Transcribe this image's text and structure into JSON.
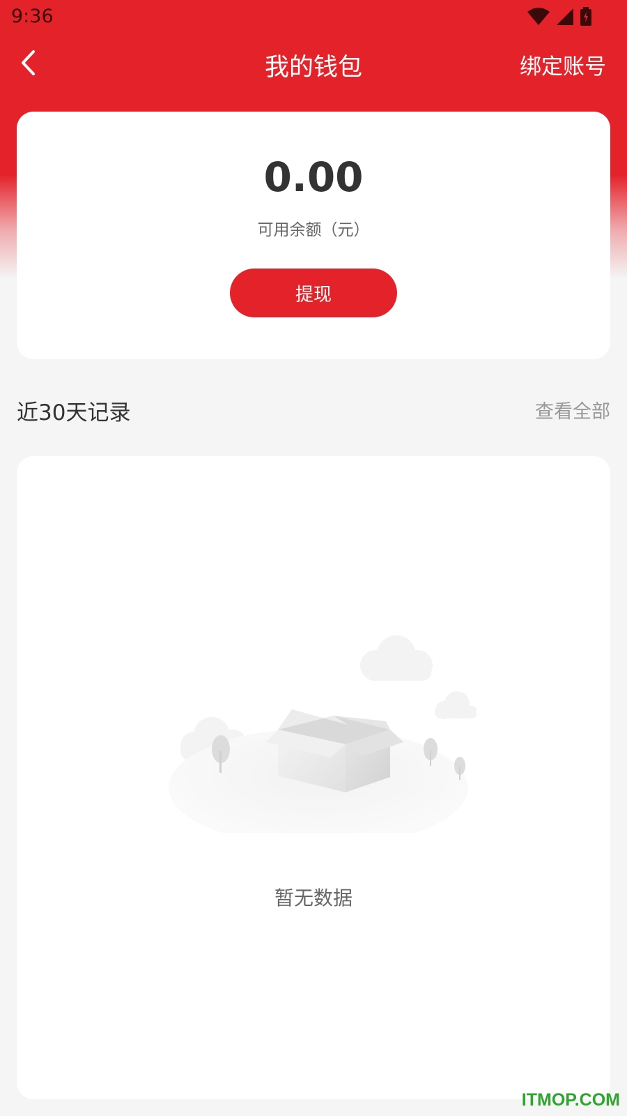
{
  "status_bar": {
    "time": "9:36",
    "icons": [
      "wifi-icon",
      "signal-icon",
      "battery-charging-icon"
    ]
  },
  "nav": {
    "back_icon": "chevron-left-icon",
    "title": "我的钱包",
    "action_label": "绑定账号"
  },
  "balance": {
    "amount": "0.00",
    "label": "可用余额（元）",
    "withdraw_label": "提现"
  },
  "records": {
    "title": "近30天记录",
    "view_all_label": "查看全部",
    "empty_text": "暂无数据",
    "empty_icon": "empty-box-icon"
  },
  "watermark": "ITMOP.COM",
  "colors": {
    "primary": "#e4222a",
    "background": "#f5f5f5",
    "card": "#ffffff",
    "text_primary": "#333333",
    "text_secondary": "#666666",
    "text_muted": "#999999",
    "watermark": "#2ea52e"
  }
}
